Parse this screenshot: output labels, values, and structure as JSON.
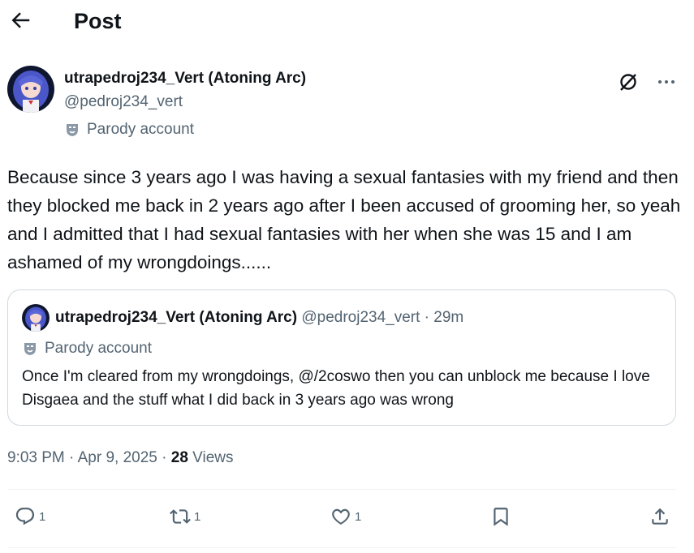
{
  "header": {
    "title": "Post"
  },
  "author": {
    "display_name": "utrapedroj234_Vert (Atoning Arc)",
    "handle": "@pedroj234_vert",
    "parody_label": "Parody account"
  },
  "post": {
    "text": "Because since 3 years ago I was having a sexual fantasies with my friend and then they blocked me back in 2 years ago after I been accused of grooming her, so yeah and I admitted that I had sexual fantasies with her when she was 15 and I am ashamed of my wrongdoings......"
  },
  "quote": {
    "display_name": "utrapedroj234_Vert (Atoning Arc)",
    "handle": "@pedroj234_vert",
    "separator": " · ",
    "time": "29m",
    "parody_label": "Parody account",
    "text": "Once I'm cleared from my wrongdoings, @/2coswo then you can unblock me because I love Disgaea and the stuff what I did back in 3 years ago was wrong"
  },
  "meta": {
    "time": "9:03 PM",
    "date": "Apr 9, 2025",
    "views_count": "28",
    "views_label": "Views",
    "sep": " · "
  },
  "actions": {
    "replies": "1",
    "reposts": "1",
    "likes": "1"
  },
  "icons": [
    "back-arrow-icon",
    "grok-icon",
    "more-icon",
    "parody-mask-icon",
    "reply-icon",
    "repost-icon",
    "like-icon",
    "bookmark-icon",
    "share-icon"
  ],
  "colors": {
    "text": "#0f1419",
    "secondary": "#536471",
    "border": "#cfd9de",
    "avatar_hair": "#4b56c9"
  }
}
